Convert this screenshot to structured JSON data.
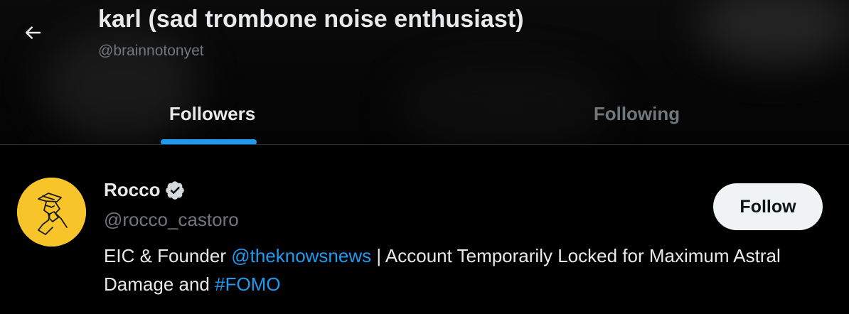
{
  "header": {
    "back_icon": "arrow-left-icon",
    "title": "karl (sad trombone noise enthusiast)",
    "handle": "@brainnotonyet"
  },
  "tabs": [
    {
      "label": "Followers",
      "active": true
    },
    {
      "label": "Following",
      "active": false
    }
  ],
  "colors": {
    "accent": "#1d9bf0",
    "background": "#000000",
    "primary_text": "#e7e9ea",
    "secondary_text": "#71767b",
    "avatar_bg": "#f7c52a",
    "button_bg": "#eff3f4"
  },
  "followers": [
    {
      "name": "Rocco",
      "verified_icon": "verified-badge-icon",
      "handle": "@rocco_castoro",
      "follow_label": "Follow",
      "bio": {
        "part1": "EIC & Founder ",
        "mention": "@theknowsnews",
        "part2": " | Account Temporarily Locked for Maximum Astral Damage and ",
        "hashtag": "#FOMO"
      }
    }
  ]
}
